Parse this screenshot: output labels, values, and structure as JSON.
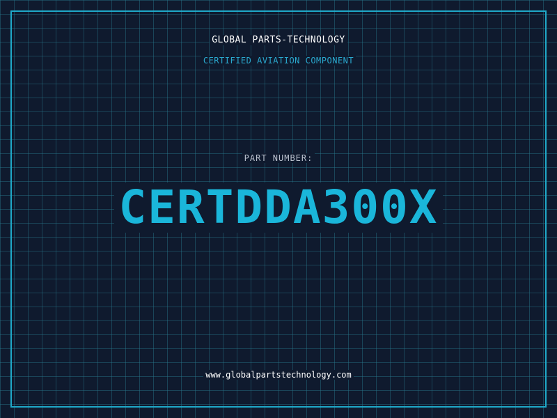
{
  "brand": {
    "name": "GLOBAL PARTS-TECHNOLOGY",
    "tagline": "CERTIFIED AVIATION COMPONENT"
  },
  "part": {
    "label": "PART NUMBER:",
    "number": "CERTDDA300X"
  },
  "footer": {
    "website": "www.globalpartstechnology.com"
  },
  "colors": {
    "background": "#0f1a2e",
    "grid": "#28788c",
    "accent": "#1ab6da",
    "frame": "#1fa9c9",
    "text": "#ffffff",
    "muted": "#b8bfcc"
  }
}
